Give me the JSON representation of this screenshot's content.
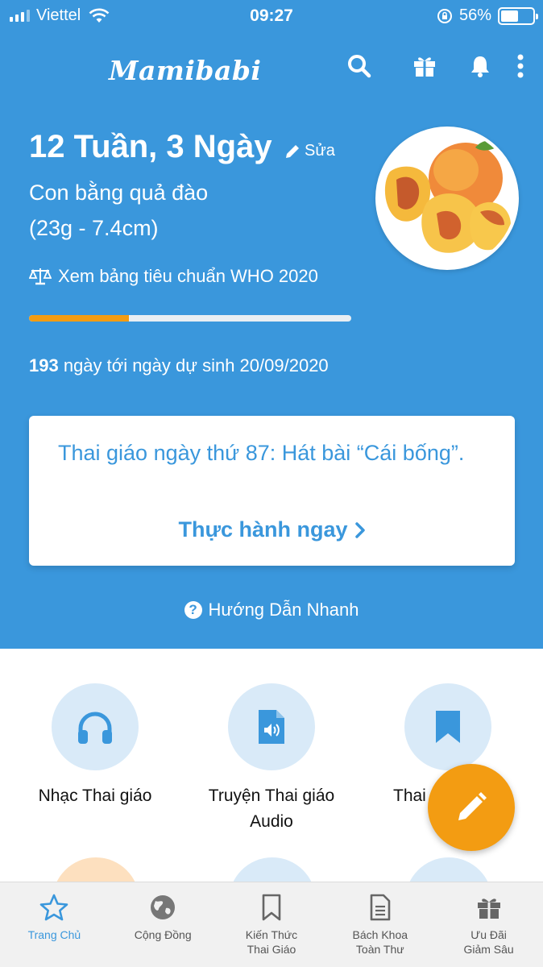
{
  "status_bar": {
    "carrier": "Viettel",
    "time": "09:27",
    "battery": "56%",
    "battery_level": 0.56
  },
  "header": {
    "logo": "Mamibabi",
    "icons": [
      "search-icon",
      "gift-icon",
      "bell-icon",
      "more-vertical-icon"
    ]
  },
  "pregnancy": {
    "week_label": "12 Tuần, 3 Ngày",
    "edit_label": "Sửa",
    "fruit_compare": "Con bằng quả đào",
    "size_info": "(23g - 7.4cm)",
    "who_link": "Xem bảng tiêu chuẩn WHO 2020",
    "progress_fraction": 0.31,
    "days_left": "193",
    "due_text": " ngày tới ngày dự sinh 20/09/2020"
  },
  "card": {
    "text": "Thai giáo ngày thứ 87: Hát bài “Cái bống”.",
    "action": "Thực hành ngay"
  },
  "guide_label": "Hướng Dẫn Nhanh",
  "tiles": [
    {
      "label": "Nhạc Thai giáo",
      "icon": "headphones-icon"
    },
    {
      "label": "Truyện Thai giáo Audio",
      "icon": "audio-file-icon"
    },
    {
      "label": "Thai",
      "icon": "bookmark-icon"
    }
  ],
  "nav": [
    {
      "label": "Trang Chủ",
      "icon": "star-icon",
      "active": true
    },
    {
      "label": "Cộng Đồng",
      "icon": "globe-icon"
    },
    {
      "label": "Kiến Thức Thai Giáo",
      "line1": "Kiến Thức",
      "line2": "Thai Giáo",
      "icon": "bookmark-icon"
    },
    {
      "label": "Bách Khoa Toàn Thư",
      "line1": "Bách Khoa",
      "line2": "Toàn Thư",
      "icon": "document-icon"
    },
    {
      "label": "Ưu Đãi Giảm Sâu",
      "line1": "Ưu Đãi",
      "line2": "Giảm Sâu",
      "icon": "gift-icon"
    }
  ],
  "colors": {
    "primary": "#3a97dc",
    "accent": "#f39c12",
    "light_blue": "#d9eaf8"
  }
}
